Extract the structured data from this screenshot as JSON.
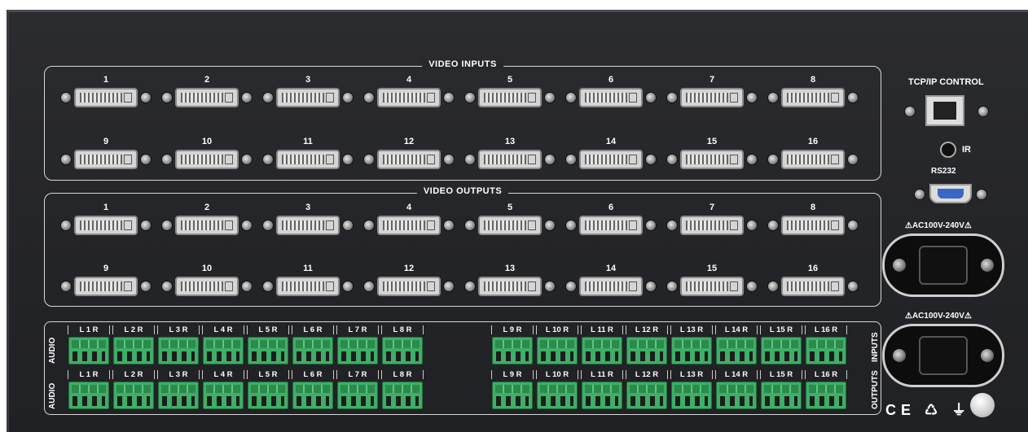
{
  "video_inputs": {
    "title": "VIDEO INPUTS",
    "ports": [
      "1",
      "2",
      "3",
      "4",
      "5",
      "6",
      "7",
      "8",
      "9",
      "10",
      "11",
      "12",
      "13",
      "14",
      "15",
      "16"
    ]
  },
  "video_outputs": {
    "title": "VIDEO OUTPUTS",
    "ports": [
      "1",
      "2",
      "3",
      "4",
      "5",
      "6",
      "7",
      "8",
      "9",
      "10",
      "11",
      "12",
      "13",
      "14",
      "15",
      "16"
    ]
  },
  "audio_inputs": {
    "side_label_left": "AUDIO",
    "side_label_right": "INPUTS",
    "groups": [
      "L 1 R",
      "L 2 R",
      "L 3 R",
      "L 4 R",
      "L 5 R",
      "L 6 R",
      "L 7 R",
      "L 8 R",
      "L 9 R",
      "L 10 R",
      "L 11 R",
      "L 12 R",
      "L 13 R",
      "L 14 R",
      "L 15 R",
      "L 16 R"
    ]
  },
  "audio_outputs": {
    "side_label_left": "AUDIO",
    "side_label_right": "OUTPUTS",
    "groups": [
      "L 1 R",
      "L 2 R",
      "L 3 R",
      "L 4 R",
      "L 5 R",
      "L 6 R",
      "L 7 R",
      "L 8 R",
      "L 9 R",
      "L 10 R",
      "L 11 R",
      "L 12 R",
      "L 13 R",
      "L 14 R",
      "L 15 R",
      "L 16 R"
    ]
  },
  "control": {
    "tcp_label": "TCP/IP CONTROL",
    "ir_label": "IR",
    "rs232_label": "RS232"
  },
  "power": {
    "label_1": "⚠AC100V-240V⚠",
    "label_2": "⚠AC100V-240V⚠"
  },
  "certification": {
    "marks": "CE ♺ ⏚"
  }
}
